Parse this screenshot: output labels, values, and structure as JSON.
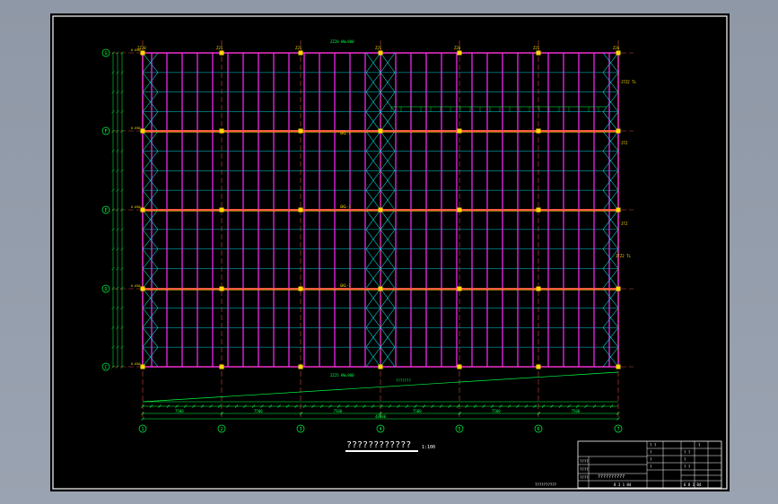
{
  "drawing": {
    "title": "????????????",
    "scale": "1:100",
    "row_axes": [
      "G",
      "F",
      "E",
      "D",
      "C"
    ],
    "col_axes": [
      "1",
      "2",
      "3",
      "4",
      "5",
      "6",
      "7"
    ],
    "top_labels": [
      "2Z20",
      "Z25",
      "Z25",
      "Z25",
      "Z20",
      "Z25",
      "Z20"
    ],
    "elev_labels": [
      "6.650",
      "6.650",
      "6.650",
      "6.650",
      "6.650"
    ],
    "callouts": [
      "JTZ2 TL",
      "JTZ",
      "GKL-1",
      "GKL-1",
      "GKL-1",
      "JTZ2 TL",
      "JTZ"
    ],
    "bottom_total": "48000",
    "bottom_spans": [
      "7500",
      "7500",
      "7500",
      "7500",
      "7500",
      "7500"
    ],
    "notes": [
      "ZZ20 HW=900",
      "ZZ25 HW=900",
      "???????"
    ]
  },
  "title_block": {
    "rows": [
      "????",
      "????",
      "????"
    ],
    "project_name": "??????????",
    "drawing_no": "??????????",
    "sheet": "8 3 1 04",
    "sheet_right": "6 8 1 04",
    "cells": [
      "? ?",
      "?",
      "?",
      "? ?",
      "?",
      "?",
      "?",
      "? ?"
    ]
  },
  "colors": {
    "frame": "#ffffff",
    "column": "#ff2cff",
    "purlin": "#00d6e0",
    "brace": "#00e1e1",
    "axis": "#ff5a44",
    "dim": "#00ff44",
    "highlight": "#ffd800"
  }
}
